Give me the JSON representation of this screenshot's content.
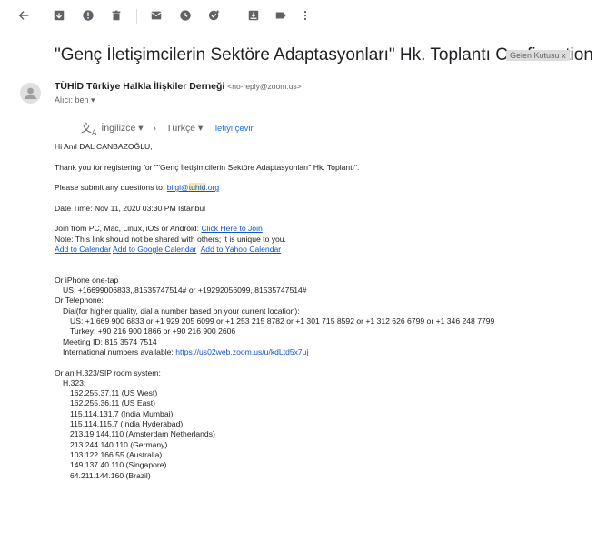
{
  "toolbar": {
    "icons": [
      "back-arrow-icon",
      "archive-icon",
      "report-spam-icon",
      "delete-icon",
      "mark-unread-icon",
      "snooze-icon",
      "add-to-tasks-icon",
      "move-to-icon",
      "labels-icon",
      "more-options-icon"
    ]
  },
  "subject": "\"Genç İletişimcilerin Sektöre Adaptasyonları\" Hk. Toplantı Confirmation",
  "label_chip": "Gelen Kutusu",
  "label_close": "x",
  "sender": {
    "name": "TÜHİD Türkiye Halkla İlişkiler Derneği",
    "email": "<no-reply@zoom.us>"
  },
  "recipient": "Alıcı: ben",
  "translate": {
    "from_lang": "İngilizce",
    "to_lang": "Türkçe",
    "action": "İletiyi çevir"
  },
  "body": {
    "greeting": "Hi Anıl DAL CANBAZOĞLU,",
    "thanks": "Thank you for registering for \"\"Genç İletişimcilerin Sektöre Adaptasyonları\" Hk. Toplantı\".",
    "questions_prefix": "Please submit any questions to: ",
    "questions_email_a": "bilgi@",
    "questions_email_b": "tuhid",
    "questions_email_c": ".org",
    "datetime": "Date Time: Nov 11, 2020 03:30 PM Istanbul",
    "join_prefix": "Join from PC, Mac, Linux, iOS or Android: ",
    "join_link": "Click Here to Join",
    "note": "Note: This link should not be shared with others; it is unique to you.",
    "calendar_links": [
      "Add to Calendar",
      "Add to Google Calendar",
      "Add to Yahoo Calendar"
    ],
    "iphone_heading": "Or iPhone one-tap",
    "iphone_us": "US: +16699006833,,81535747514# or +19292056099,,81535747514#",
    "telephone_heading": "Or Telephone:",
    "dial_note": "Dial(for higher quality, dial a number based on your current location):",
    "dial_us": "US: +1 669 900 6833 or +1 929 205 6099 or +1 253 215 8782 or +1 301 715 8592 or +1 312 626 6799 or +1 346 248 7799",
    "dial_turkey": "Turkey: +90 216 900 1866 or +90 216 900 2606",
    "meeting_id": "Meeting ID: 815 3574 7514",
    "intl_prefix": "International numbers available: ",
    "intl_link": "https://us02web.zoom.us/u/kdLtd5x7uj",
    "sip_heading": "Or an H.323/SIP room system:",
    "h323_heading": "H.323:",
    "h323_ips": [
      "162.255.37.11 (US West)",
      "162.255.36.11 (US East)",
      "115.114.131.7 (India Mumbai)",
      "115.114.115.7 (India Hyderabad)",
      "213.19.144.110 (Amsterdam Netherlands)",
      "213.244.140.110 (Germany)",
      "103.122.166.55 (Australia)",
      "149.137.40.110 (Singapore)",
      "64.211.144.160 (Brazil)"
    ]
  }
}
